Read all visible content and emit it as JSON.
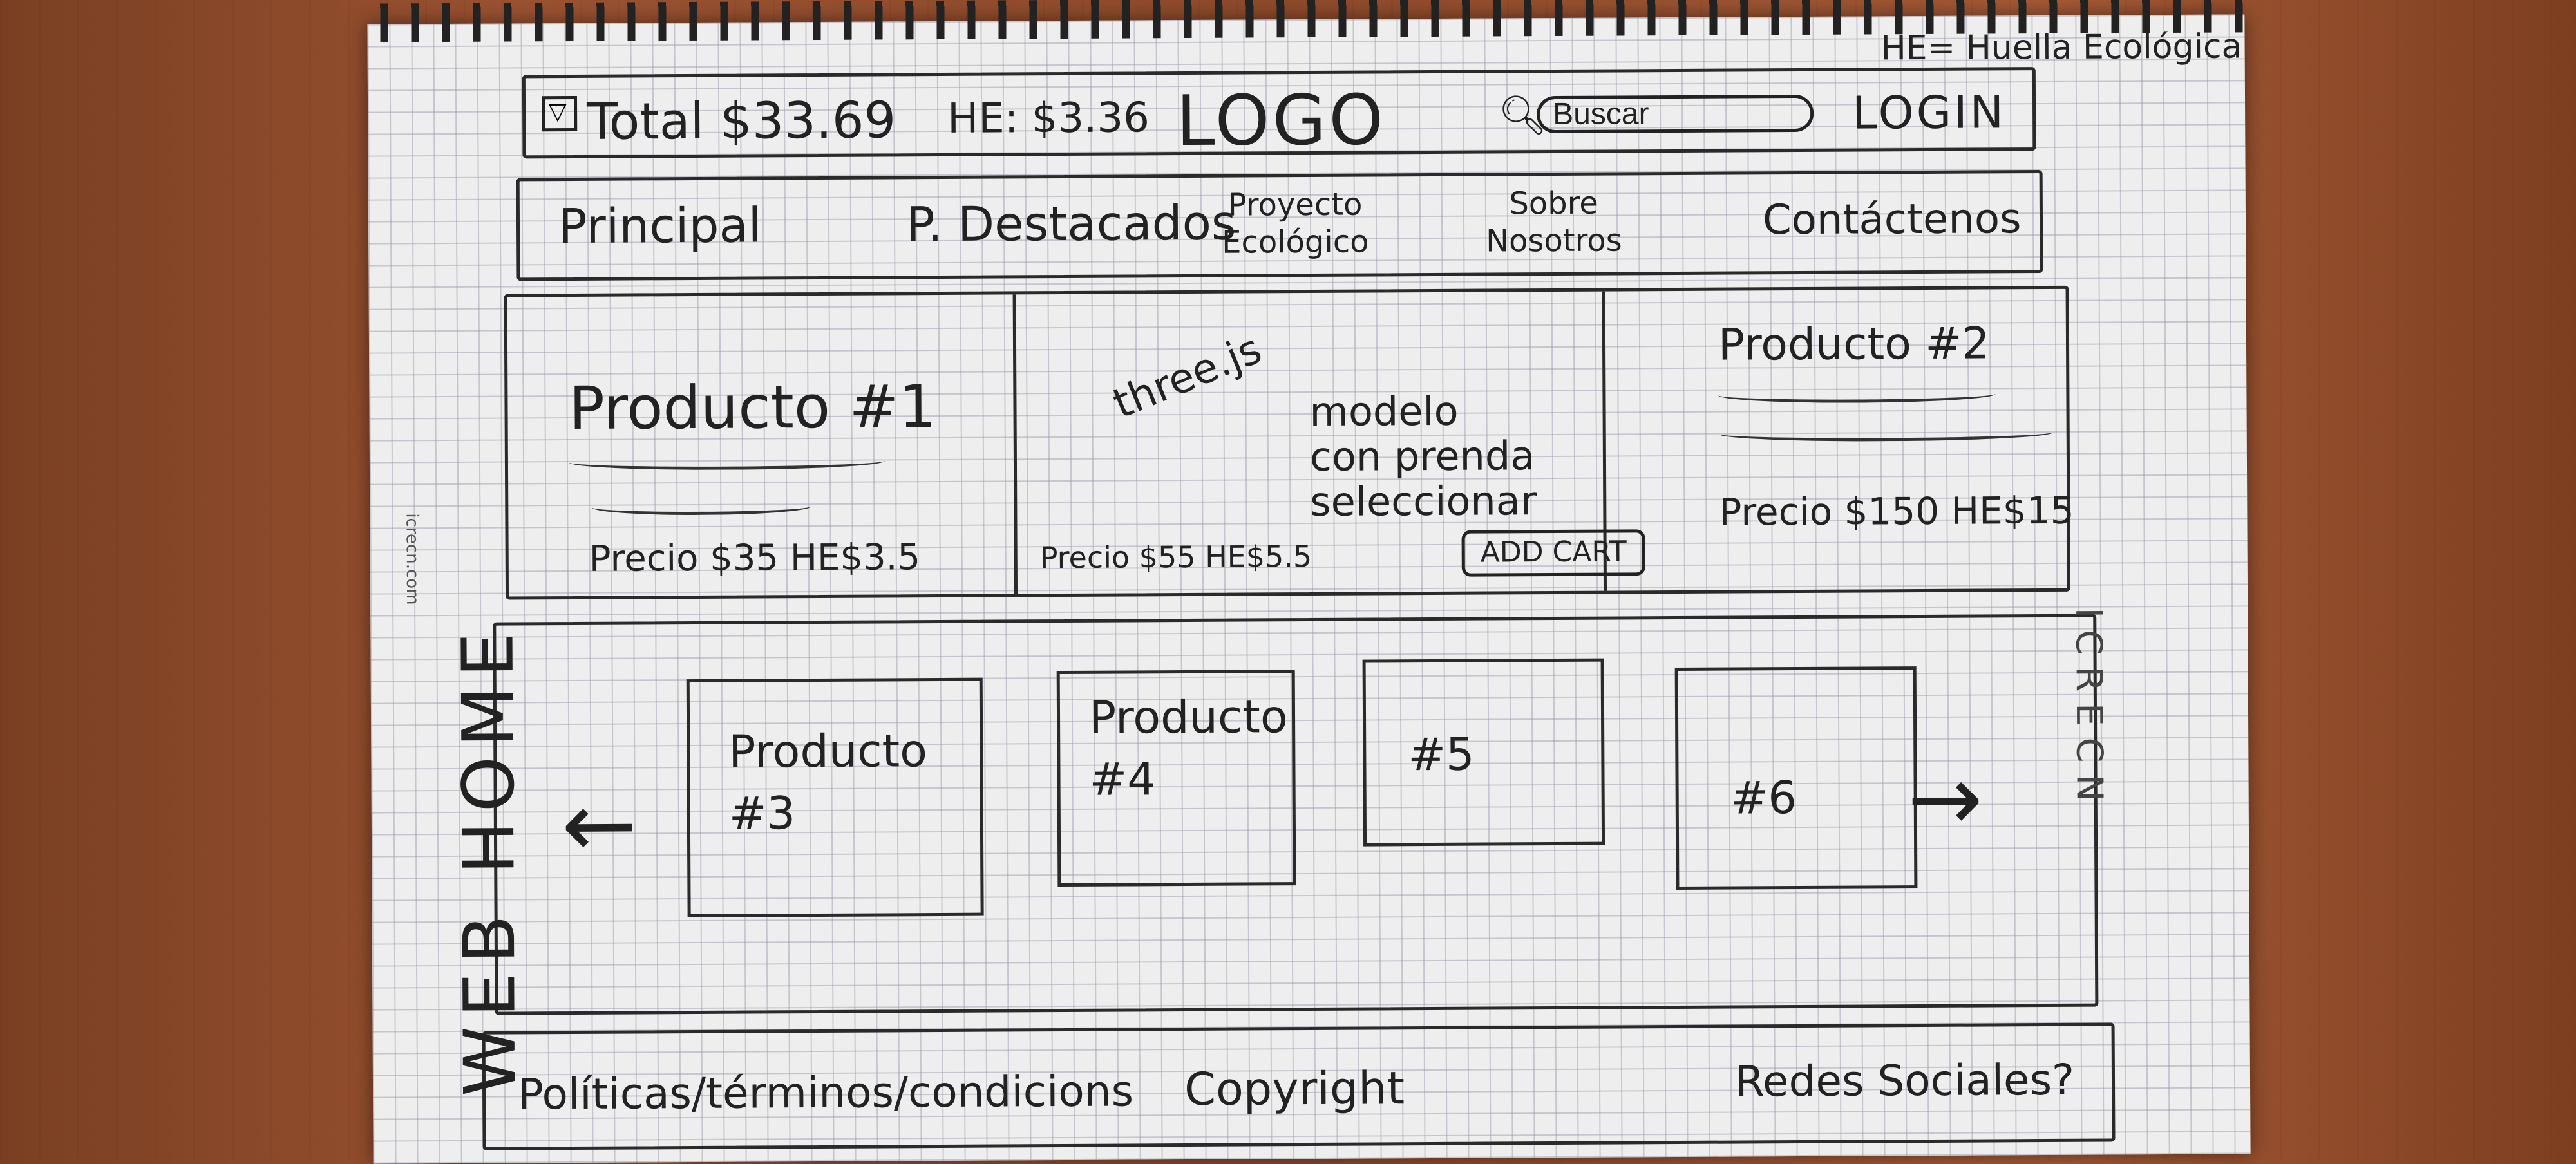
{
  "header_note": "HE= Huella Ecológica",
  "header": {
    "total": "Total $33.69",
    "he": "HE: $3.36",
    "logo": "LOGO",
    "search_placeholder": "Buscar",
    "login": "LOGIN"
  },
  "nav": {
    "items": [
      "Principal",
      "P. Destacados",
      "Proyecto\nEcológico",
      "Sobre\nNosotros",
      "Contáctenos"
    ]
  },
  "hero": {
    "product1_title": "Producto #1",
    "product1_price": "Precio $35 HE$3.5",
    "three_label": "three.js",
    "center_text": "modelo\ncon prenda\nseleccionar",
    "center_price": "Precio $55 HE$5.5",
    "add_cart": "ADD CART",
    "product2_title": "Producto #2",
    "product2_price": "Precio $150 HE$15"
  },
  "carousel": {
    "cards": [
      "Producto\n#3",
      "Producto\n#4",
      "#5",
      "#6"
    ]
  },
  "footer": {
    "left": "Políticas/términos/condicions",
    "middle": "Copyright",
    "right": "Redes Sociales?"
  },
  "side_label": "WEB HOME",
  "brand_right": "ICRECN",
  "brand_small": "icrecn.com"
}
